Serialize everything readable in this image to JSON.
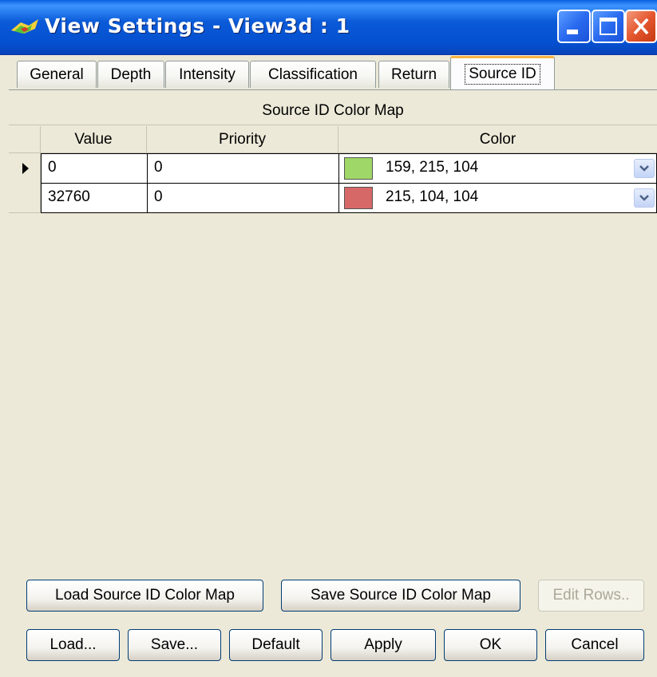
{
  "window": {
    "title": "View Settings - View3d : 1"
  },
  "tabs": [
    "General",
    "Depth",
    "Intensity",
    "Classification",
    "Return",
    "Source ID"
  ],
  "active_tab": "Source ID",
  "section_title": "Source ID Color Map",
  "grid": {
    "headers": {
      "value": "Value",
      "priority": "Priority",
      "color": "Color"
    },
    "rows": [
      {
        "value": "0",
        "priority": "0",
        "color_text": "159, 215, 104",
        "swatch": "#9fd768"
      },
      {
        "value": "32760",
        "priority": "0",
        "color_text": "215, 104, 104",
        "swatch": "#d76868"
      }
    ]
  },
  "buttons": {
    "load_map": "Load Source ID Color Map",
    "save_map": "Save Source ID Color Map",
    "edit_rows": "Edit Rows..",
    "load": "Load...",
    "save": "Save...",
    "default": "Default",
    "apply": "Apply",
    "ok": "OK",
    "cancel": "Cancel"
  },
  "icons": {
    "app": "terrain-icon",
    "minimize": "minimize-icon",
    "maximize": "maximize-icon",
    "close": "close-icon"
  }
}
